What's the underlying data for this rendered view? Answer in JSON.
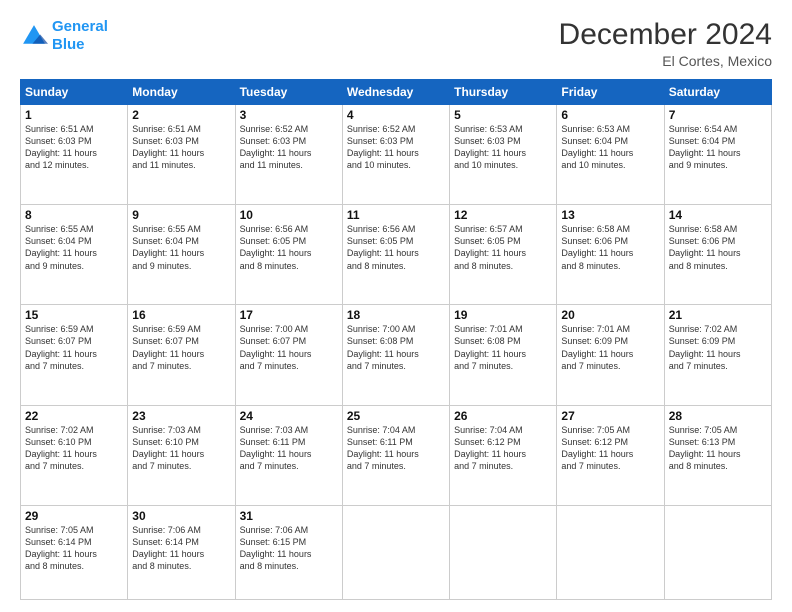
{
  "logo": {
    "line1": "General",
    "line2": "Blue"
  },
  "title": "December 2024",
  "subtitle": "El Cortes, Mexico",
  "days_header": [
    "Sunday",
    "Monday",
    "Tuesday",
    "Wednesday",
    "Thursday",
    "Friday",
    "Saturday"
  ],
  "weeks": [
    [
      {
        "day": "1",
        "info": "Sunrise: 6:51 AM\nSunset: 6:03 PM\nDaylight: 11 hours\nand 12 minutes."
      },
      {
        "day": "2",
        "info": "Sunrise: 6:51 AM\nSunset: 6:03 PM\nDaylight: 11 hours\nand 11 minutes."
      },
      {
        "day": "3",
        "info": "Sunrise: 6:52 AM\nSunset: 6:03 PM\nDaylight: 11 hours\nand 11 minutes."
      },
      {
        "day": "4",
        "info": "Sunrise: 6:52 AM\nSunset: 6:03 PM\nDaylight: 11 hours\nand 10 minutes."
      },
      {
        "day": "5",
        "info": "Sunrise: 6:53 AM\nSunset: 6:03 PM\nDaylight: 11 hours\nand 10 minutes."
      },
      {
        "day": "6",
        "info": "Sunrise: 6:53 AM\nSunset: 6:04 PM\nDaylight: 11 hours\nand 10 minutes."
      },
      {
        "day": "7",
        "info": "Sunrise: 6:54 AM\nSunset: 6:04 PM\nDaylight: 11 hours\nand 9 minutes."
      }
    ],
    [
      {
        "day": "8",
        "info": "Sunrise: 6:55 AM\nSunset: 6:04 PM\nDaylight: 11 hours\nand 9 minutes."
      },
      {
        "day": "9",
        "info": "Sunrise: 6:55 AM\nSunset: 6:04 PM\nDaylight: 11 hours\nand 9 minutes."
      },
      {
        "day": "10",
        "info": "Sunrise: 6:56 AM\nSunset: 6:05 PM\nDaylight: 11 hours\nand 8 minutes."
      },
      {
        "day": "11",
        "info": "Sunrise: 6:56 AM\nSunset: 6:05 PM\nDaylight: 11 hours\nand 8 minutes."
      },
      {
        "day": "12",
        "info": "Sunrise: 6:57 AM\nSunset: 6:05 PM\nDaylight: 11 hours\nand 8 minutes."
      },
      {
        "day": "13",
        "info": "Sunrise: 6:58 AM\nSunset: 6:06 PM\nDaylight: 11 hours\nand 8 minutes."
      },
      {
        "day": "14",
        "info": "Sunrise: 6:58 AM\nSunset: 6:06 PM\nDaylight: 11 hours\nand 8 minutes."
      }
    ],
    [
      {
        "day": "15",
        "info": "Sunrise: 6:59 AM\nSunset: 6:07 PM\nDaylight: 11 hours\nand 7 minutes."
      },
      {
        "day": "16",
        "info": "Sunrise: 6:59 AM\nSunset: 6:07 PM\nDaylight: 11 hours\nand 7 minutes."
      },
      {
        "day": "17",
        "info": "Sunrise: 7:00 AM\nSunset: 6:07 PM\nDaylight: 11 hours\nand 7 minutes."
      },
      {
        "day": "18",
        "info": "Sunrise: 7:00 AM\nSunset: 6:08 PM\nDaylight: 11 hours\nand 7 minutes."
      },
      {
        "day": "19",
        "info": "Sunrise: 7:01 AM\nSunset: 6:08 PM\nDaylight: 11 hours\nand 7 minutes."
      },
      {
        "day": "20",
        "info": "Sunrise: 7:01 AM\nSunset: 6:09 PM\nDaylight: 11 hours\nand 7 minutes."
      },
      {
        "day": "21",
        "info": "Sunrise: 7:02 AM\nSunset: 6:09 PM\nDaylight: 11 hours\nand 7 minutes."
      }
    ],
    [
      {
        "day": "22",
        "info": "Sunrise: 7:02 AM\nSunset: 6:10 PM\nDaylight: 11 hours\nand 7 minutes."
      },
      {
        "day": "23",
        "info": "Sunrise: 7:03 AM\nSunset: 6:10 PM\nDaylight: 11 hours\nand 7 minutes."
      },
      {
        "day": "24",
        "info": "Sunrise: 7:03 AM\nSunset: 6:11 PM\nDaylight: 11 hours\nand 7 minutes."
      },
      {
        "day": "25",
        "info": "Sunrise: 7:04 AM\nSunset: 6:11 PM\nDaylight: 11 hours\nand 7 minutes."
      },
      {
        "day": "26",
        "info": "Sunrise: 7:04 AM\nSunset: 6:12 PM\nDaylight: 11 hours\nand 7 minutes."
      },
      {
        "day": "27",
        "info": "Sunrise: 7:05 AM\nSunset: 6:12 PM\nDaylight: 11 hours\nand 7 minutes."
      },
      {
        "day": "28",
        "info": "Sunrise: 7:05 AM\nSunset: 6:13 PM\nDaylight: 11 hours\nand 8 minutes."
      }
    ],
    [
      {
        "day": "29",
        "info": "Sunrise: 7:05 AM\nSunset: 6:14 PM\nDaylight: 11 hours\nand 8 minutes."
      },
      {
        "day": "30",
        "info": "Sunrise: 7:06 AM\nSunset: 6:14 PM\nDaylight: 11 hours\nand 8 minutes."
      },
      {
        "day": "31",
        "info": "Sunrise: 7:06 AM\nSunset: 6:15 PM\nDaylight: 11 hours\nand 8 minutes."
      },
      null,
      null,
      null,
      null
    ]
  ]
}
